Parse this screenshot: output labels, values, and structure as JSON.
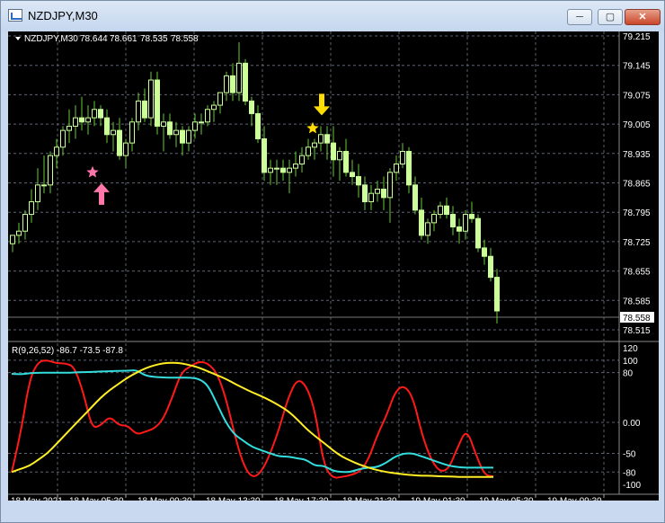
{
  "window": {
    "title": "NZDJPY,M30",
    "buttons": {
      "minimize": "─",
      "maximize": "▢",
      "close": "✕"
    }
  },
  "chart_header": {
    "symbol": "NZDJPY,M30",
    "open": "78.644",
    "high": "78.661",
    "low": "78.535",
    "close": "78.558",
    "current_price_label": "78.558"
  },
  "indicator_header": {
    "text": "R(9,26,52) -86.7 -73.5 -87.8"
  },
  "colors": {
    "bull": "#000000",
    "bull_outline": "#ccff99",
    "bear": "#ccff99",
    "wick": "#66cc33",
    "red_line": "#ff1a1a",
    "cyan_line": "#33dddd",
    "yellow_line": "#ffee22",
    "buy_arrow": "#ff77aa",
    "sell_arrow": "#ffdd00"
  },
  "price_axis": {
    "labels": [
      "79.215",
      "79.145",
      "79.075",
      "79.005",
      "78.935",
      "78.865",
      "78.795",
      "78.725",
      "78.655",
      "78.585",
      "78.515"
    ]
  },
  "indicator_axis": {
    "labels": [
      "120",
      "100",
      "80",
      "0.00",
      "-50",
      "-80",
      "-100"
    ]
  },
  "time_axis": {
    "labels": [
      "18 May 2021",
      "18 May 05:30",
      "18 May 09:30",
      "18 May 13:30",
      "18 May 17:30",
      "18 May 21:30",
      "19 May 01:30",
      "19 May 05:30",
      "19 May 09:30"
    ]
  },
  "chart_data": [
    {
      "type": "candlestick",
      "title": "NZDJPY,M30",
      "ylim": [
        78.515,
        79.215
      ],
      "candles": [
        [
          78.72,
          78.74,
          78.7,
          78.74
        ],
        [
          78.74,
          78.77,
          78.72,
          78.75
        ],
        [
          78.75,
          78.8,
          78.73,
          78.79
        ],
        [
          78.79,
          78.85,
          78.77,
          78.82
        ],
        [
          78.82,
          78.9,
          78.8,
          78.86
        ],
        [
          78.86,
          78.93,
          78.84,
          78.86
        ],
        [
          78.86,
          78.94,
          78.84,
          78.93
        ],
        [
          78.93,
          78.97,
          78.9,
          78.95
        ],
        [
          78.95,
          79.0,
          78.93,
          78.99
        ],
        [
          78.99,
          79.04,
          78.96,
          79.0
        ],
        [
          79.0,
          79.05,
          78.97,
          79.02
        ],
        [
          79.02,
          79.07,
          78.99,
          79.01
        ],
        [
          79.01,
          79.05,
          78.98,
          79.02
        ],
        [
          79.02,
          79.06,
          79.0,
          79.04
        ],
        [
          79.04,
          79.05,
          79.0,
          79.02
        ],
        [
          79.02,
          79.04,
          78.96,
          78.98
        ],
        [
          78.98,
          79.01,
          78.94,
          78.99
        ],
        [
          78.99,
          79.02,
          78.92,
          78.93
        ],
        [
          78.93,
          78.97,
          78.9,
          78.96
        ],
        [
          78.96,
          79.02,
          78.94,
          79.01
        ],
        [
          79.01,
          79.08,
          78.99,
          79.06
        ],
        [
          79.06,
          79.09,
          79.01,
          79.02
        ],
        [
          79.02,
          79.13,
          79.0,
          79.11
        ],
        [
          79.11,
          79.13,
          78.98,
          79.0
        ],
        [
          79.0,
          79.03,
          78.94,
          79.01
        ],
        [
          79.01,
          79.03,
          78.97,
          78.98
        ],
        [
          78.98,
          79.01,
          78.95,
          78.99
        ],
        [
          78.99,
          79.0,
          78.93,
          78.96
        ],
        [
          78.96,
          79.0,
          78.94,
          78.99
        ],
        [
          78.99,
          79.03,
          78.97,
          79.01
        ],
        [
          79.01,
          79.03,
          78.98,
          79.01
        ],
        [
          79.01,
          79.05,
          79.0,
          79.04
        ],
        [
          79.04,
          79.06,
          79.01,
          79.05
        ],
        [
          79.05,
          79.08,
          79.03,
          79.08
        ],
        [
          79.08,
          79.13,
          79.06,
          79.12
        ],
        [
          79.12,
          79.15,
          79.06,
          79.08
        ],
        [
          79.08,
          79.2,
          79.06,
          79.15
        ],
        [
          79.15,
          79.16,
          79.05,
          79.06
        ],
        [
          79.06,
          79.07,
          79.0,
          79.03
        ],
        [
          79.03,
          79.05,
          78.96,
          78.97
        ],
        [
          78.97,
          79.0,
          78.87,
          78.89
        ],
        [
          78.89,
          78.92,
          78.86,
          78.9
        ],
        [
          78.9,
          78.92,
          78.86,
          78.9
        ],
        [
          78.9,
          78.92,
          78.87,
          78.89
        ],
        [
          78.89,
          78.92,
          78.84,
          78.9
        ],
        [
          78.9,
          78.94,
          78.88,
          78.91
        ],
        [
          78.91,
          78.95,
          78.89,
          78.93
        ],
        [
          78.93,
          78.97,
          78.92,
          78.95
        ],
        [
          78.95,
          78.97,
          78.92,
          78.96
        ],
        [
          78.96,
          79.0,
          78.94,
          78.98
        ],
        [
          78.98,
          79.0,
          78.92,
          78.96
        ],
        [
          78.96,
          79.0,
          78.88,
          78.92
        ],
        [
          78.92,
          78.95,
          78.87,
          78.94
        ],
        [
          78.94,
          78.97,
          78.88,
          78.89
        ],
        [
          78.89,
          78.92,
          78.86,
          78.88
        ],
        [
          78.88,
          78.91,
          78.83,
          78.86
        ],
        [
          78.86,
          78.88,
          78.8,
          78.82
        ],
        [
          78.82,
          78.86,
          78.8,
          78.84
        ],
        [
          78.84,
          78.87,
          78.82,
          78.85
        ],
        [
          78.85,
          78.88,
          78.8,
          78.83
        ],
        [
          78.83,
          78.9,
          78.77,
          78.89
        ],
        [
          78.89,
          78.93,
          78.87,
          78.91
        ],
        [
          78.91,
          78.96,
          78.9,
          78.94
        ],
        [
          78.94,
          78.95,
          78.84,
          78.86
        ],
        [
          78.86,
          78.88,
          78.79,
          78.8
        ],
        [
          78.8,
          78.83,
          78.73,
          78.74
        ],
        [
          78.74,
          78.78,
          78.72,
          78.77
        ],
        [
          78.77,
          78.8,
          78.75,
          78.79
        ],
        [
          78.79,
          78.82,
          78.78,
          78.81
        ],
        [
          78.81,
          78.83,
          78.78,
          78.79
        ],
        [
          78.79,
          78.81,
          78.74,
          78.76
        ],
        [
          78.76,
          78.78,
          78.72,
          78.75
        ],
        [
          78.75,
          78.8,
          78.73,
          78.79
        ],
        [
          78.79,
          78.82,
          78.77,
          78.78
        ],
        [
          78.78,
          78.79,
          78.7,
          78.71
        ],
        [
          78.71,
          78.73,
          78.67,
          78.69
        ],
        [
          78.69,
          78.71,
          78.63,
          78.64
        ],
        [
          78.64,
          78.66,
          78.53,
          78.56
        ]
      ]
    },
    {
      "type": "line",
      "title": "R(9,26,52)",
      "ylim": [
        -110,
        120
      ],
      "series": [
        {
          "name": "R(9)",
          "values": [
            -80,
            -20,
            70,
            98,
            100,
            95,
            95,
            90,
            50,
            -10,
            -5,
            10,
            -5,
            -5,
            -20,
            -15,
            -10,
            5,
            40,
            80,
            90,
            98,
            95,
            80,
            40,
            -20,
            -70,
            -90,
            -80,
            -50,
            -10,
            40,
            70,
            60,
            20,
            -70,
            -90,
            -88,
            -85,
            -80,
            -60,
            -20,
            10,
            50,
            60,
            40,
            -20,
            -60,
            -80,
            -75,
            -40,
            -10,
            -50,
            -85,
            -87
          ]
        },
        {
          "name": "R(26)",
          "values": [
            78,
            77,
            79,
            80,
            80,
            80,
            80,
            80,
            81,
            81,
            82,
            82,
            83,
            83,
            84,
            75,
            73,
            72,
            72,
            72,
            72,
            70,
            60,
            30,
            0,
            -20,
            -30,
            -40,
            -45,
            -50,
            -55,
            -55,
            -58,
            -60,
            -70,
            -70,
            -78,
            -80,
            -80,
            -75,
            -73,
            -72,
            -65,
            -55,
            -50,
            -50,
            -55,
            -60,
            -65,
            -70,
            -72,
            -73,
            -73,
            -73,
            -73
          ]
        },
        {
          "name": "R(52)",
          "values": [
            -80,
            -75,
            -70,
            -60,
            -50,
            -35,
            -20,
            -5,
            10,
            25,
            40,
            52,
            62,
            72,
            80,
            87,
            92,
            95,
            96,
            95,
            92,
            88,
            82,
            76,
            70,
            62,
            55,
            48,
            42,
            35,
            27,
            18,
            5,
            -10,
            -22,
            -33,
            -45,
            -55,
            -62,
            -68,
            -73,
            -77,
            -80,
            -82,
            -84,
            -85,
            -86,
            -86,
            -87,
            -87,
            -88,
            -88,
            -88,
            -88,
            -88
          ]
        }
      ]
    }
  ],
  "markers": [
    {
      "name": "buy-arrow",
      "type": "up-arrow",
      "candle": 14,
      "price": 78.86
    },
    {
      "name": "buy-star",
      "type": "star",
      "candle": 14,
      "price": 78.89
    },
    {
      "name": "sell-arrow",
      "type": "down-arrow",
      "candle": 49,
      "price": 79.03
    },
    {
      "name": "sell-star",
      "type": "star",
      "candle": 49,
      "price": 78.995
    }
  ]
}
